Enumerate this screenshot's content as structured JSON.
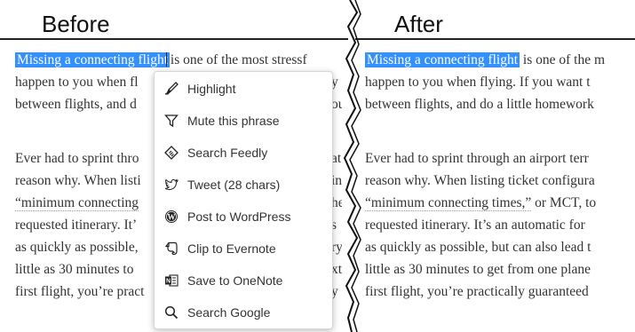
{
  "headers": {
    "before": "Before",
    "after": "After"
  },
  "article": {
    "selection": "Missing a connecting flight",
    "before_lines": [
      " is one of the most stressf",
      "happen to you when fl",
      "between flights, and d",
      "Ever had to sprint thro",
      "reason why. When listi",
      "“minimum connecting",
      "requested itinerary. It’",
      "as quickly as possible,",
      "little as 30 minutes to",
      "first flight, you’re pract"
    ],
    "before_right_fragments": [
      "y",
      "ou",
      "at",
      "in",
      "he",
      "s",
      "ry",
      "xt",
      "y"
    ],
    "after_lines": [
      " is one of the m",
      "happen to you when flying. If you want t",
      "between flights, and do a little homework",
      "Ever had to sprint through an airport terr",
      "reason why. When listing ticket configura",
      "“minimum connecting times,” or MCT, to",
      "requested itinerary. It’s an automatic for",
      "as quickly as possible, but can also lead t",
      "little as 30 minutes to get from one plane",
      "first flight, you’re practically guaranteed"
    ],
    "after_mct_text": "“minimum connecting times,”"
  },
  "context_menu": {
    "items": [
      {
        "label": "Highlight",
        "icon": "highlighter-icon"
      },
      {
        "label": "Mute this phrase",
        "icon": "filter-icon"
      },
      {
        "label": "Search Feedly",
        "icon": "feedly-icon"
      },
      {
        "label": "Tweet (28 chars)",
        "icon": "twitter-icon"
      },
      {
        "label": "Post to WordPress",
        "icon": "wordpress-icon"
      },
      {
        "label": "Clip to Evernote",
        "icon": "evernote-icon"
      },
      {
        "label": "Save to OneNote",
        "icon": "onenote-icon"
      },
      {
        "label": "Search Google",
        "icon": "search-icon"
      }
    ]
  },
  "colors": {
    "selection": "#3390ff",
    "text": "#333333",
    "menu_border": "#d6d6d6"
  }
}
